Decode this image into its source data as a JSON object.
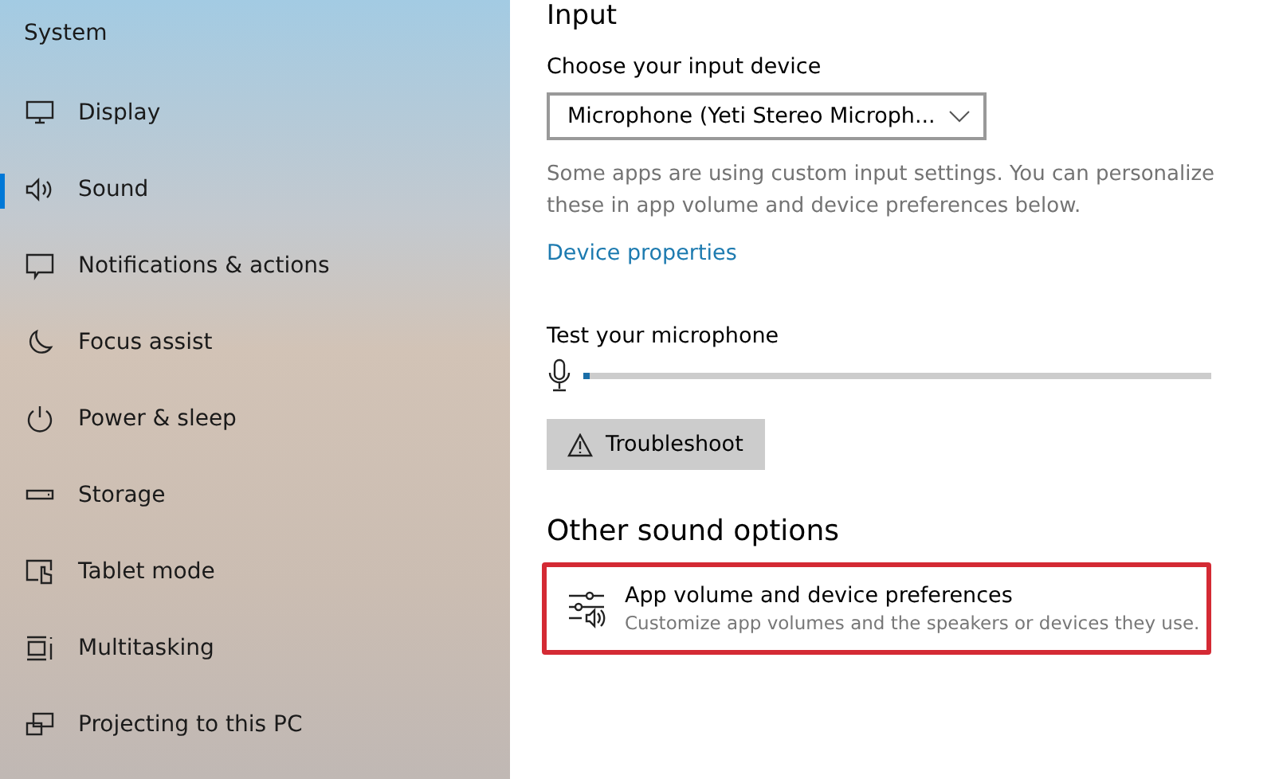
{
  "sidebar": {
    "title": "System",
    "items": [
      {
        "label": "Display",
        "kind": "display",
        "selected": false
      },
      {
        "label": "Sound",
        "kind": "sound",
        "selected": true
      },
      {
        "label": "Notifications & actions",
        "kind": "notifications",
        "selected": false
      },
      {
        "label": "Focus assist",
        "kind": "focus",
        "selected": false
      },
      {
        "label": "Power & sleep",
        "kind": "power",
        "selected": false
      },
      {
        "label": "Storage",
        "kind": "storage",
        "selected": false
      },
      {
        "label": "Tablet mode",
        "kind": "tablet",
        "selected": false
      },
      {
        "label": "Multitasking",
        "kind": "multitasking",
        "selected": false
      },
      {
        "label": "Projecting to this PC",
        "kind": "projecting",
        "selected": false
      }
    ]
  },
  "input": {
    "heading": "Input",
    "device_label": "Choose your input device",
    "device_value": "Microphone (Yeti Stereo Microph...",
    "note": "Some apps are using custom input settings. You can personalize these in app volume and device preferences below.",
    "link": "Device properties",
    "test_label": "Test your microphone",
    "mic_level": {
      "level": 0.01
    },
    "troubleshoot": "Troubleshoot"
  },
  "other": {
    "heading": "Other sound options",
    "option": {
      "title": "App volume and device preferences",
      "description": "Customize app volumes and the speakers or devices they use.",
      "highlighted": true
    }
  }
}
